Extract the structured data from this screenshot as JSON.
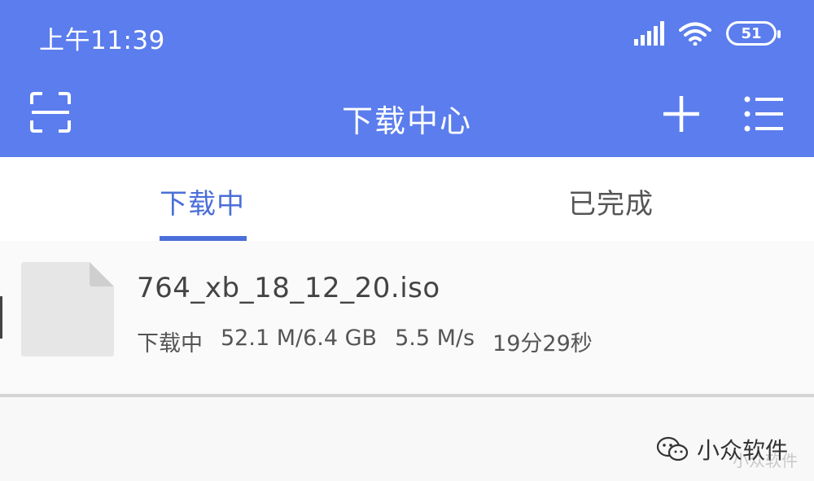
{
  "status_bar": {
    "time": "上午11:39",
    "battery": "51"
  },
  "header": {
    "title": "下载中心",
    "icons": {
      "scan": "scan-icon",
      "add": "plus-icon",
      "menu": "list-menu-icon"
    },
    "color": "#5b7ded"
  },
  "tabs": [
    {
      "label": "下载中",
      "active": true
    },
    {
      "label": "已完成",
      "active": false
    }
  ],
  "downloads": [
    {
      "file_name": "764_xb_18_12_20.iso",
      "status": "下载中",
      "progress": "52.1 M/6.4 GB",
      "speed": "5.5 M/s",
      "remaining": "19分29秒"
    }
  ],
  "watermark": {
    "text": "小众软件",
    "sub_text": "小众软件"
  },
  "colors": {
    "accent": "#4b6fd8"
  }
}
